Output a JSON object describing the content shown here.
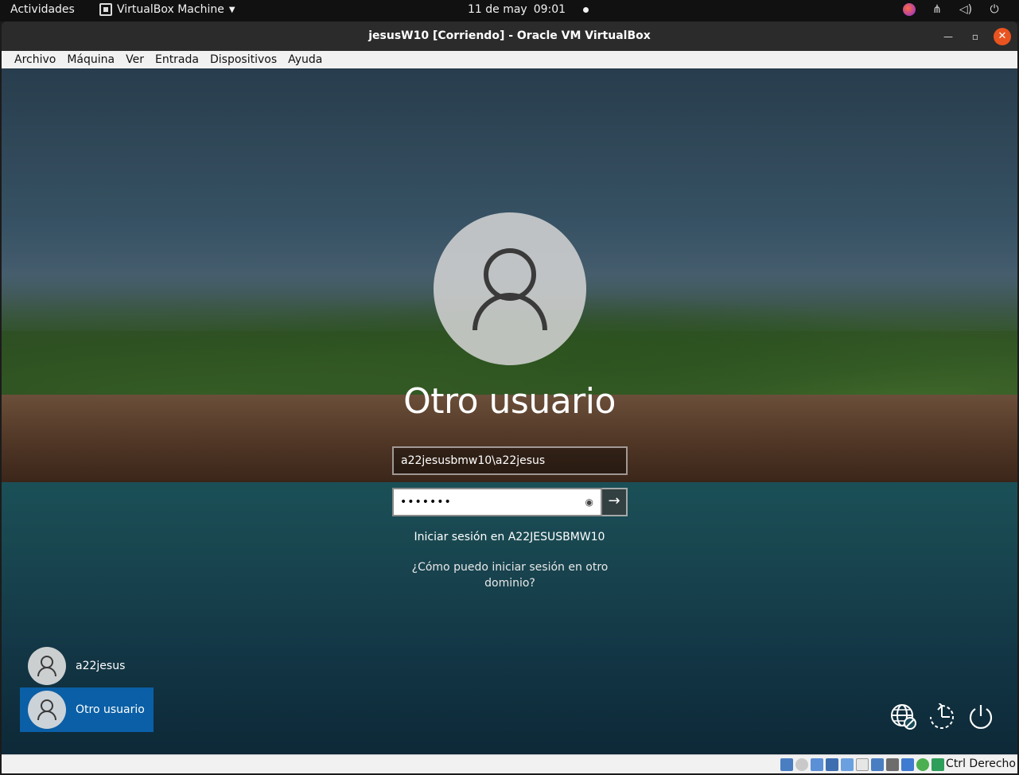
{
  "topbar": {
    "activities": "Actividades",
    "app_name": "VirtualBox Machine",
    "date": "11 de may",
    "time": "09:01",
    "tray_icons": [
      "firefox-icon",
      "network-icon",
      "volume-icon",
      "power-icon"
    ]
  },
  "window": {
    "title": "jesusW10 [Corriendo] - Oracle VM VirtualBox",
    "controls": [
      "minimize-icon",
      "maximize-icon",
      "close-icon"
    ],
    "close_color": "#e95420"
  },
  "menu": {
    "items": [
      "Archivo",
      "Máquina",
      "Ver",
      "Entrada",
      "Dispositivos",
      "Ayuda"
    ]
  },
  "login": {
    "display_name": "Otro usuario",
    "username_value": "a22jesusbmw10\\a22jesus",
    "password_mask": "•••••••",
    "submit_icon": "arrow-right-icon",
    "signin_to": "Iniciar sesión en A22JESUSBMW10",
    "other_domain_help": "¿Cómo puedo iniciar sesión en otro dominio?"
  },
  "users": [
    {
      "name": "a22jesus",
      "selected": false
    },
    {
      "name": "Otro usuario",
      "selected": true
    }
  ],
  "selected_color": "#0a5fa6",
  "bottom_icons": [
    "network-globe-icon",
    "ease-of-access-icon",
    "power-icon"
  ],
  "statusbar": {
    "host_key": "Ctrl Derecho",
    "device_icons": [
      "hard-disk-icon",
      "optical-drive-icon",
      "audio-icon",
      "network-adapter-icon",
      "usb-icon",
      "shared-folders-icon",
      "display-icon",
      "recording-icon",
      "virtualization-icon",
      "mouse-integration-icon",
      "keyboard-icon"
    ]
  }
}
